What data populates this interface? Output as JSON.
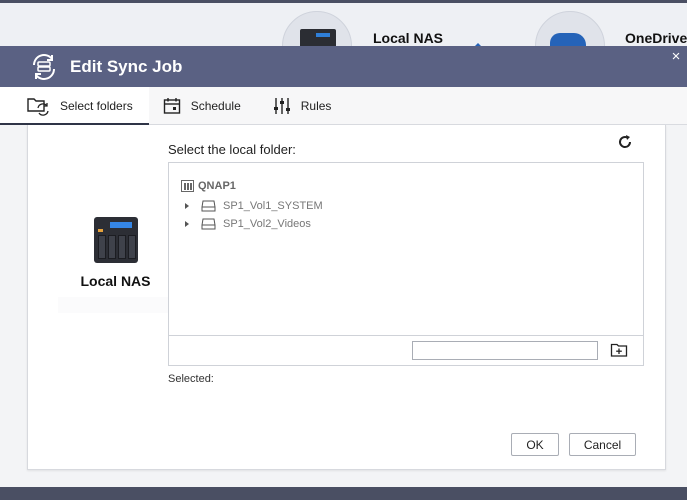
{
  "background": {
    "local_nas_label": "Local NAS",
    "onedrive_label": "OneDrive"
  },
  "dialog": {
    "title": "Edit Sync Job",
    "close_glyph": "×",
    "title_icon": "sync-icon"
  },
  "tabs": [
    {
      "label": "Select folders",
      "icon": "folder-sync-icon",
      "active": true
    },
    {
      "label": "Schedule",
      "icon": "calendar-icon",
      "active": false
    },
    {
      "label": "Rules",
      "icon": "sliders-icon",
      "active": false
    }
  ],
  "sidebar": {
    "label": "Local NAS",
    "icon": "nas-device-icon"
  },
  "folder_picker": {
    "prompt": "Select the local folder:",
    "root": "QNAP1",
    "items": [
      {
        "label": "SP1_Vol1_SYSTEM",
        "icon": "drive-icon"
      },
      {
        "label": "SP1_Vol2_Videos",
        "icon": "drive-icon"
      }
    ],
    "path_value": "",
    "selected_label": "Selected:"
  },
  "buttons": {
    "ok": "OK",
    "cancel": "Cancel"
  },
  "colors": {
    "titlebar": "#5a6183",
    "accent_blue": "#2f7fd8"
  }
}
